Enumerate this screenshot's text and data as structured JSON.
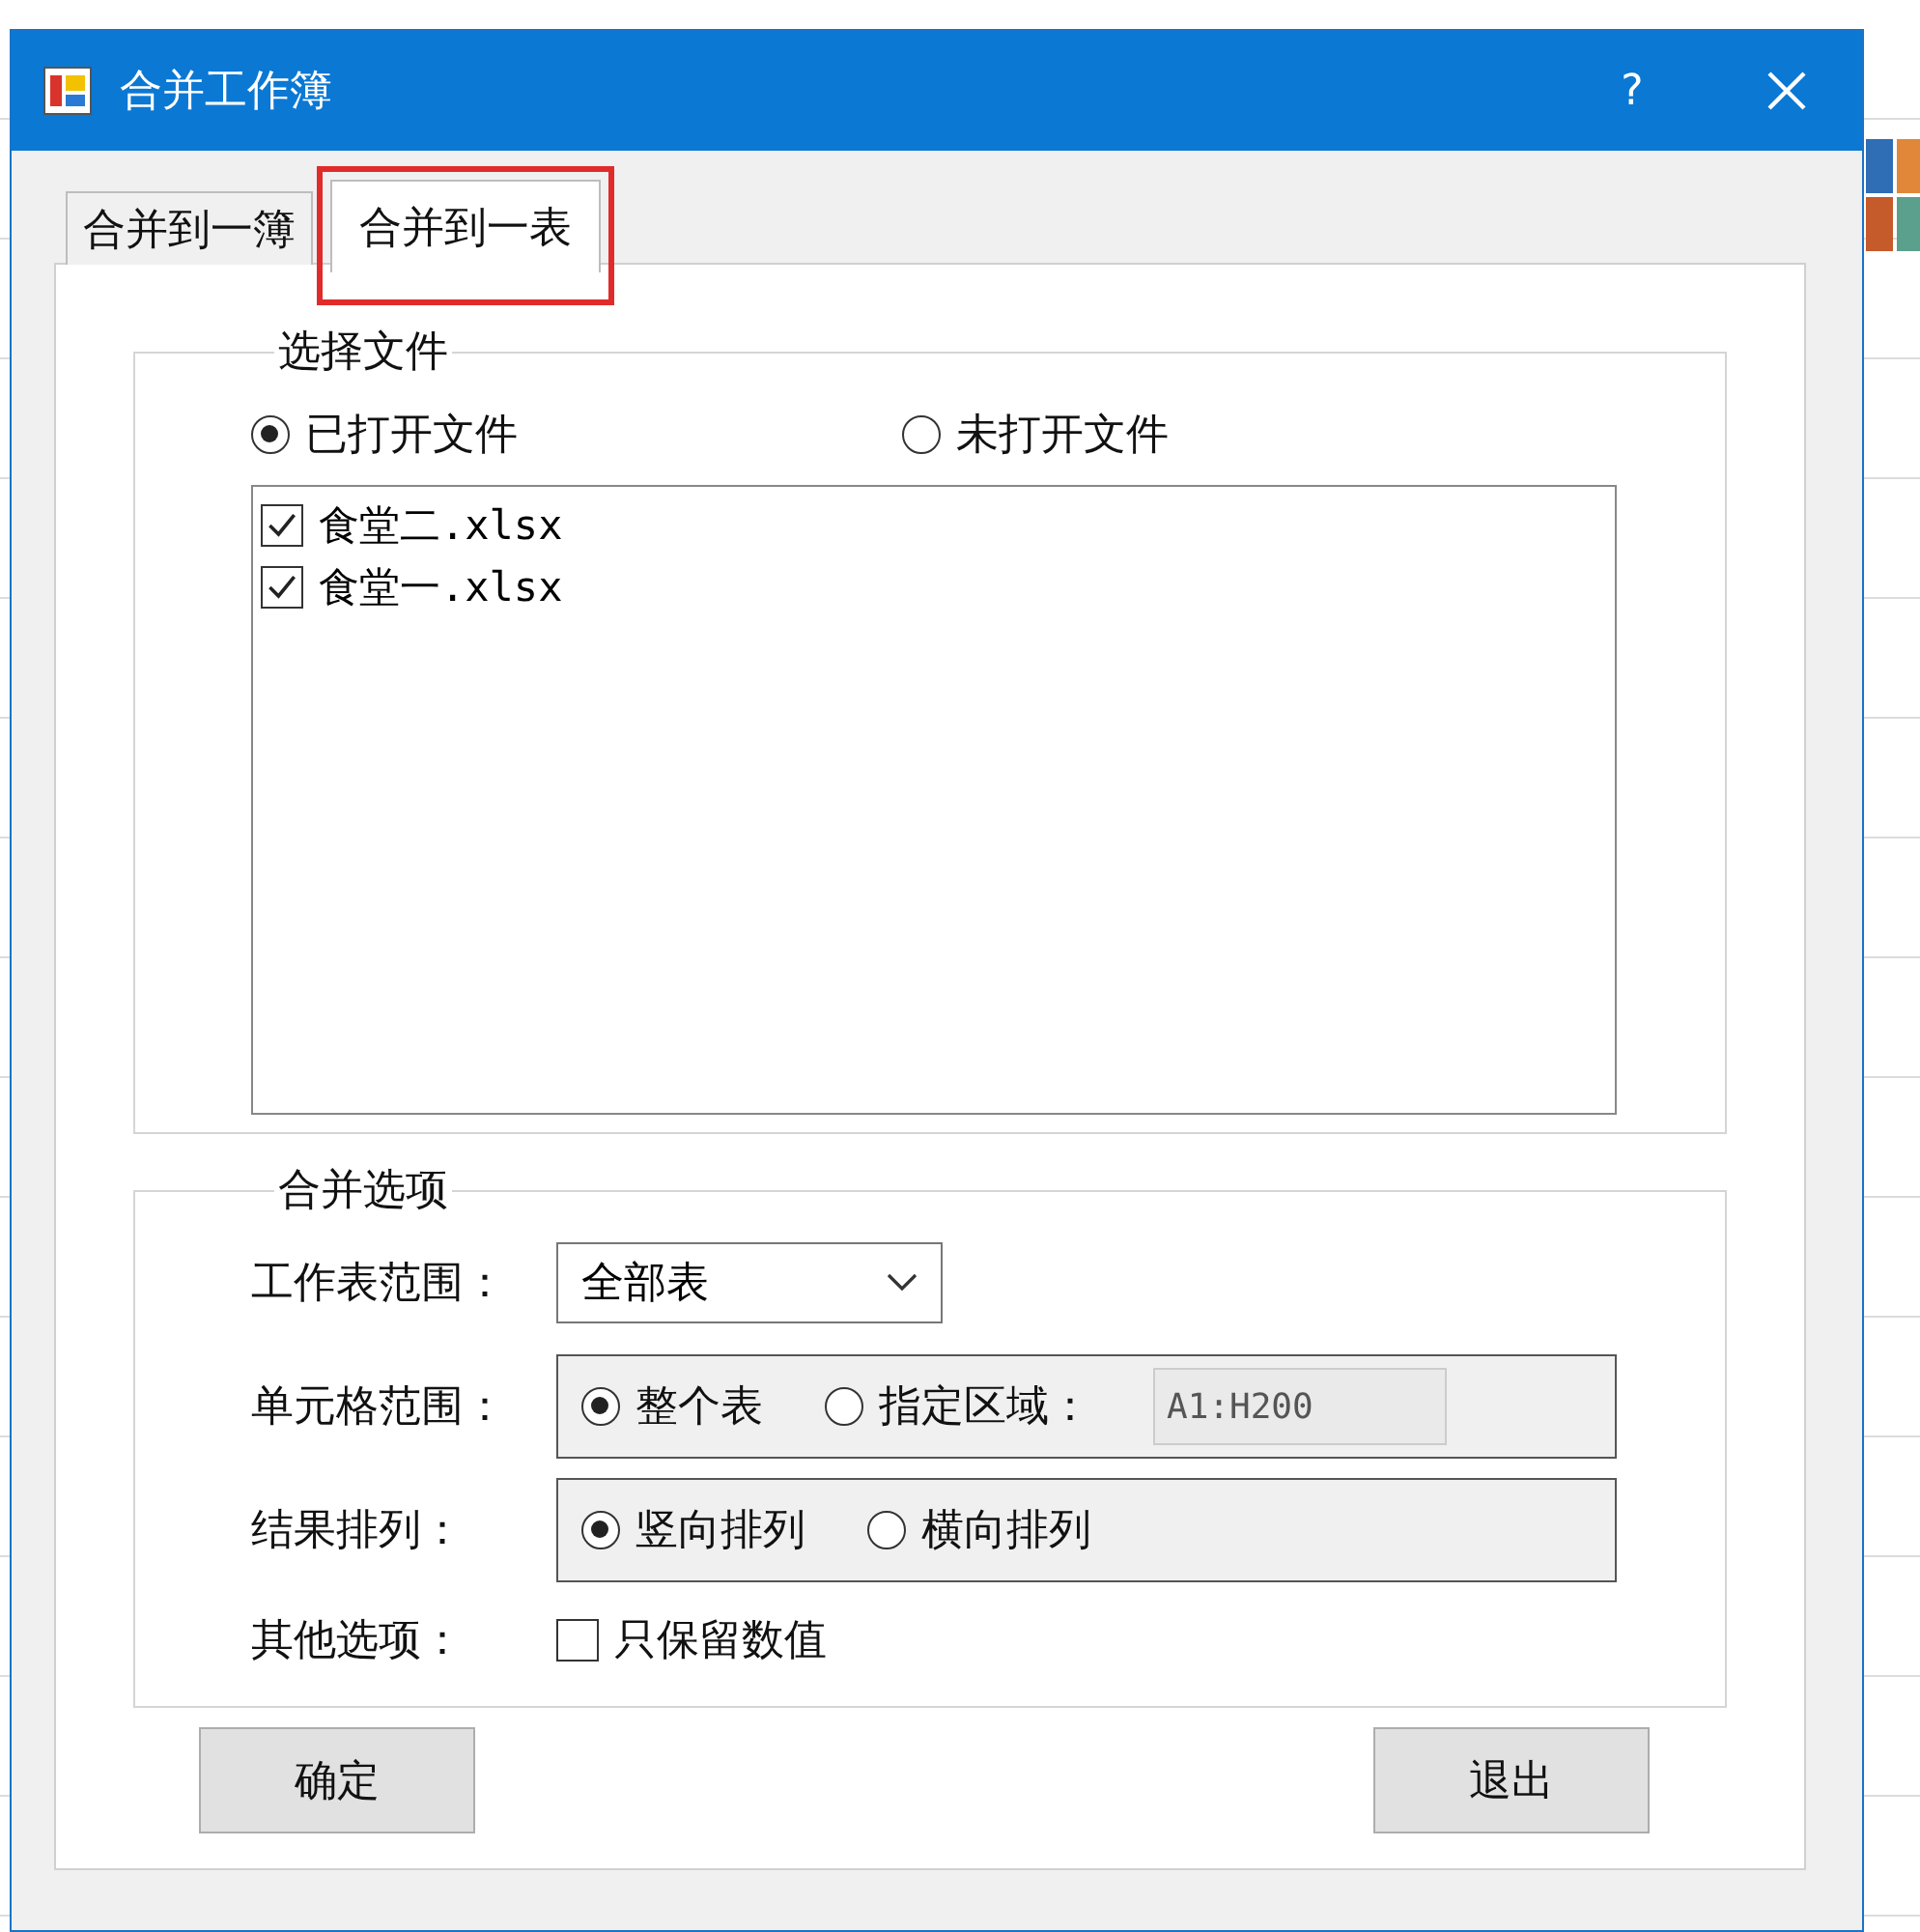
{
  "window": {
    "title": "合并工作簿",
    "help": "?"
  },
  "tabs": [
    {
      "label": "合并到一簿",
      "selected": false,
      "highlighted": false
    },
    {
      "label": "合并到一表",
      "selected": true,
      "highlighted": true
    }
  ],
  "file_group": {
    "title": "选择文件",
    "sources": [
      {
        "label": "已打开文件",
        "selected": true
      },
      {
        "label": "未打开文件",
        "selected": false
      }
    ],
    "files": [
      {
        "name": "食堂二.xlsx",
        "checked": true
      },
      {
        "name": "食堂一.xlsx",
        "checked": true
      }
    ]
  },
  "options_group": {
    "title": "合并选项",
    "rows": [
      {
        "kind": "dropdown",
        "label": "工作表范围：",
        "value": "全部表"
      },
      {
        "kind": "radios",
        "label": "单元格范围：",
        "options": [
          {
            "label": "整个表",
            "selected": true
          },
          {
            "label": "指定区域：",
            "selected": false
          }
        ],
        "range_field": {
          "value": "A1:H200",
          "disabled": true
        }
      },
      {
        "kind": "radios",
        "label": "结果排列：",
        "options": [
          {
            "label": "竖向排列",
            "selected": true
          },
          {
            "label": "横向排列",
            "selected": false
          }
        ]
      },
      {
        "kind": "checkbox",
        "label": "其他选项：",
        "option": {
          "label": "只保留数值",
          "checked": false
        }
      }
    ]
  },
  "buttons": [
    "确定",
    "退出"
  ]
}
